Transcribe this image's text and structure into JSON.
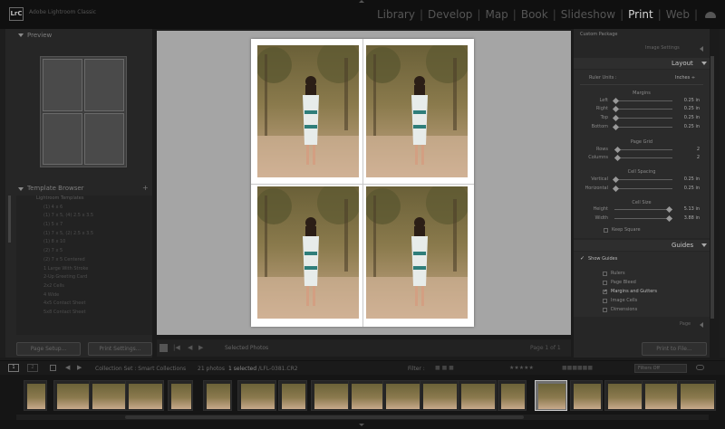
{
  "app": {
    "name": "Adobe Lightroom Classic",
    "logo": "LrC"
  },
  "modules": [
    {
      "label": "Library",
      "active": false
    },
    {
      "label": "Develop",
      "active": false
    },
    {
      "label": "Map",
      "active": false
    },
    {
      "label": "Book",
      "active": false
    },
    {
      "label": "Slideshow",
      "active": false
    },
    {
      "label": "Print",
      "active": true
    },
    {
      "label": "Web",
      "active": false
    }
  ],
  "left_panel": {
    "preview_title": "Preview",
    "template_browser_title": "Template Browser",
    "template_folder": "Lightroom Templates",
    "templates": [
      "(1) 4 x 6",
      "(1) 7 x 5, (4) 2.5 x 3.5",
      "(1) 5 x 7",
      "(1) 7 x 5, (2) 2.5 x 3.5",
      "(1) 8 x 10",
      "(2) 7 x 5",
      "(2) 7 x 5 Centered",
      "1 Large With Stroke",
      "2-Up Greeting Card",
      "2x2 Cells",
      "4 Wide",
      "4x5 Contact Sheet",
      "5x8 Contact Sheet"
    ],
    "page_setup_button": "Page Setup...",
    "print_settings_button": "Print Settings..."
  },
  "toolbar": {
    "page_label": "1",
    "selection": "Selected Photos",
    "page_count": "Page 1 of 1"
  },
  "right_panel": {
    "custom_package": "Custom Package",
    "image_settings": "Image Settings",
    "layout_title": "Layout",
    "ruler_units_label": "Ruler Units :",
    "ruler_units_value": "Inches ÷",
    "margins_title": "Margins",
    "margins": [
      {
        "label": "Left",
        "value": "0.25 in",
        "level": 0.02
      },
      {
        "label": "Right",
        "value": "0.25 in",
        "level": 0.02
      },
      {
        "label": "Top",
        "value": "0.25 in",
        "level": 0.02
      },
      {
        "label": "Bottom",
        "value": "0.25 in",
        "level": 0.02
      }
    ],
    "page_grid_title": "Page Grid",
    "grid": [
      {
        "label": "Rows",
        "value": "2",
        "level": 0.05
      },
      {
        "label": "Columns",
        "value": "2",
        "level": 0.05
      }
    ],
    "cell_spacing_title": "Cell Spacing",
    "spacing": [
      {
        "label": "Vertical",
        "value": "0.25 in",
        "level": 0.02
      },
      {
        "label": "Horizontal",
        "value": "0.25 in",
        "level": 0.02
      }
    ],
    "cell_size_title": "Cell Size",
    "size": [
      {
        "label": "Height",
        "value": "5.13 in",
        "level": 0.93
      },
      {
        "label": "Width",
        "value": "3.88 in",
        "level": 0.93
      }
    ],
    "keep_square": "Keep Square",
    "guides_title": "Guides",
    "show_guides": "Show Guides",
    "guide_options": [
      {
        "label": "Rulers",
        "checked": false
      },
      {
        "label": "Page Bleed",
        "checked": false
      },
      {
        "label": "Margins and Gutters",
        "checked": true
      },
      {
        "label": "Image Cells",
        "checked": false
      },
      {
        "label": "Dimensions",
        "checked": false
      }
    ],
    "page_section": "Page",
    "print_to_file_button": "Print to File..."
  },
  "filmstrip": {
    "page1": "1",
    "page2": "2",
    "source": "Collection Set : Smart Collections",
    "count": "21 photos",
    "selected": "1 selected",
    "filename": "/LFL-0381.CR2",
    "filter_label": "Filter :",
    "filter_value": "Filters Off"
  },
  "colors": {
    "accent": "#d6d6d6",
    "panel": "#262626",
    "canvas": "#a5a5a5"
  }
}
